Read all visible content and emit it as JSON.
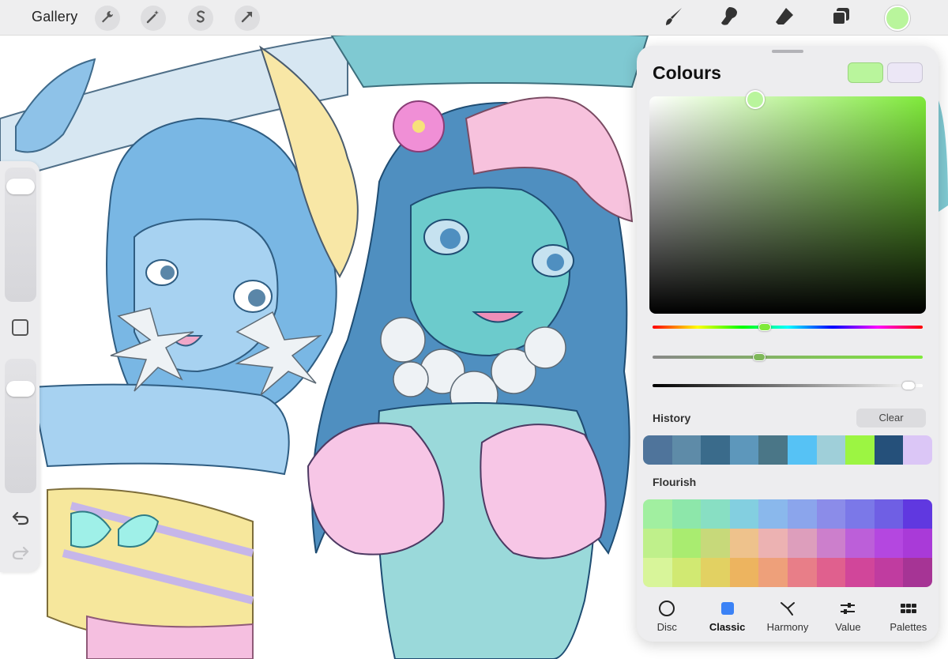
{
  "topbar": {
    "gallery_label": "Gallery",
    "left_tools": [
      "wrench-icon",
      "magic-wand-icon",
      "selection-s-icon",
      "transform-arrow-icon"
    ],
    "right_tools": [
      "brush-icon",
      "smudge-icon",
      "eraser-icon",
      "layers-icon"
    ],
    "active_colour": "#b9f59c"
  },
  "sidebar": {
    "brush_size_level": 0.92,
    "opacity_level": 0.82
  },
  "colours_panel": {
    "title": "Colours",
    "current_colour": "#b9f59c",
    "previous_colour": "#ece7f6",
    "hue_level": 0.41,
    "saturation_level": 0.39,
    "brightness_level": 0.97,
    "history_label": "History",
    "clear_label": "Clear",
    "history": [
      "#4f749b",
      "#5e8ba8",
      "#3a6b8b",
      "#5d97bb",
      "#4a7687",
      "#56c2f5",
      "#9fcfd9",
      "#9cf542",
      "#25507a",
      "#dbc6f6"
    ],
    "palette_label": "Flourish",
    "palette": [
      "#a1efa0",
      "#8de7aa",
      "#88dfc3",
      "#83cfe0",
      "#8ab8ec",
      "#8ba5ec",
      "#8b8ce9",
      "#7b78e8",
      "#6f5fe4",
      "#6038e0",
      "#bff08b",
      "#a9ec70",
      "#c7d97a",
      "#eec28c",
      "#ecb2b2",
      "#dd9ebc",
      "#cc7fcc",
      "#bc5fd9",
      "#b447e0",
      "#a93ad8",
      "#d8f59a",
      "#d1e972",
      "#e2d162",
      "#edb45f",
      "#eea07a",
      "#e87e88",
      "#e0608e",
      "#d1469a",
      "#c03ca0",
      "#a63495"
    ],
    "tabs": [
      {
        "label": "Disc",
        "icon": "disc-icon"
      },
      {
        "label": "Classic",
        "icon": "classic-square-icon"
      },
      {
        "label": "Harmony",
        "icon": "harmony-icon"
      },
      {
        "label": "Value",
        "icon": "value-sliders-icon"
      },
      {
        "label": "Palettes",
        "icon": "palettes-grid-icon"
      }
    ],
    "active_tab": "Classic",
    "accent_colour": "#3b82f6"
  }
}
